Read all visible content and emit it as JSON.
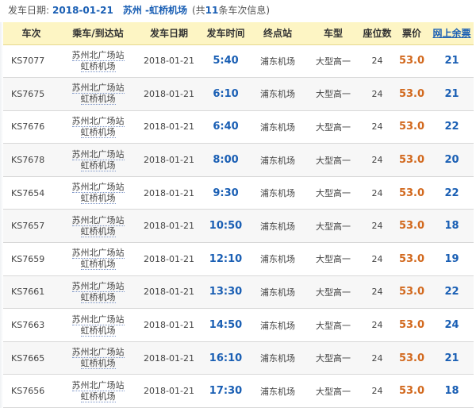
{
  "info": {
    "label": "发车日期:",
    "date": "2018-01-21",
    "route": "苏州 -虹桥机场",
    "count_prefix": "(共",
    "count": "11",
    "count_suffix": "条车次信息)"
  },
  "columns": [
    "车次",
    "乘车/到达站",
    "发车日期",
    "发车时间",
    "终点站",
    "车型",
    "座位数",
    "票价",
    "网上余票"
  ],
  "rows": [
    {
      "train": "KS7077",
      "from": "苏州北广场站",
      "to": "虹桥机场",
      "date": "2018-01-21",
      "time": "5:40",
      "terminal": "浦东机场",
      "type": "大型高一",
      "seats": "24",
      "price": "53.0",
      "remain": "21"
    },
    {
      "train": "KS7675",
      "from": "苏州北广场站",
      "to": "虹桥机场",
      "date": "2018-01-21",
      "time": "6:10",
      "terminal": "浦东机场",
      "type": "大型高一",
      "seats": "24",
      "price": "53.0",
      "remain": "21"
    },
    {
      "train": "KS7676",
      "from": "苏州北广场站",
      "to": "虹桥机场",
      "date": "2018-01-21",
      "time": "6:40",
      "terminal": "浦东机场",
      "type": "大型高一",
      "seats": "24",
      "price": "53.0",
      "remain": "22"
    },
    {
      "train": "KS7678",
      "from": "苏州北广场站",
      "to": "虹桥机场",
      "date": "2018-01-21",
      "time": "8:00",
      "terminal": "浦东机场",
      "type": "大型高一",
      "seats": "24",
      "price": "53.0",
      "remain": "20"
    },
    {
      "train": "KS7654",
      "from": "苏州北广场站",
      "to": "虹桥机场",
      "date": "2018-01-21",
      "time": "9:30",
      "terminal": "浦东机场",
      "type": "大型高一",
      "seats": "24",
      "price": "53.0",
      "remain": "22"
    },
    {
      "train": "KS7657",
      "from": "苏州北广场站",
      "to": "虹桥机场",
      "date": "2018-01-21",
      "time": "10:50",
      "terminal": "浦东机场",
      "type": "大型高一",
      "seats": "24",
      "price": "53.0",
      "remain": "18"
    },
    {
      "train": "KS7659",
      "from": "苏州北广场站",
      "to": "虹桥机场",
      "date": "2018-01-21",
      "time": "12:10",
      "terminal": "浦东机场",
      "type": "大型高一",
      "seats": "24",
      "price": "53.0",
      "remain": "19"
    },
    {
      "train": "KS7661",
      "from": "苏州北广场站",
      "to": "虹桥机场",
      "date": "2018-01-21",
      "time": "13:30",
      "terminal": "浦东机场",
      "type": "大型高一",
      "seats": "24",
      "price": "53.0",
      "remain": "22"
    },
    {
      "train": "KS7663",
      "from": "苏州北广场站",
      "to": "虹桥机场",
      "date": "2018-01-21",
      "time": "14:50",
      "terminal": "浦东机场",
      "type": "大型高一",
      "seats": "24",
      "price": "53.0",
      "remain": "24"
    },
    {
      "train": "KS7665",
      "from": "苏州北广场站",
      "to": "虹桥机场",
      "date": "2018-01-21",
      "time": "16:10",
      "terminal": "浦东机场",
      "type": "大型高一",
      "seats": "24",
      "price": "53.0",
      "remain": "21"
    },
    {
      "train": "KS7656",
      "from": "苏州北广场站",
      "to": "虹桥机场",
      "date": "2018-01-21",
      "time": "17:30",
      "terminal": "浦东机场",
      "type": "大型高一",
      "seats": "24",
      "price": "53.0",
      "remain": "18"
    }
  ]
}
